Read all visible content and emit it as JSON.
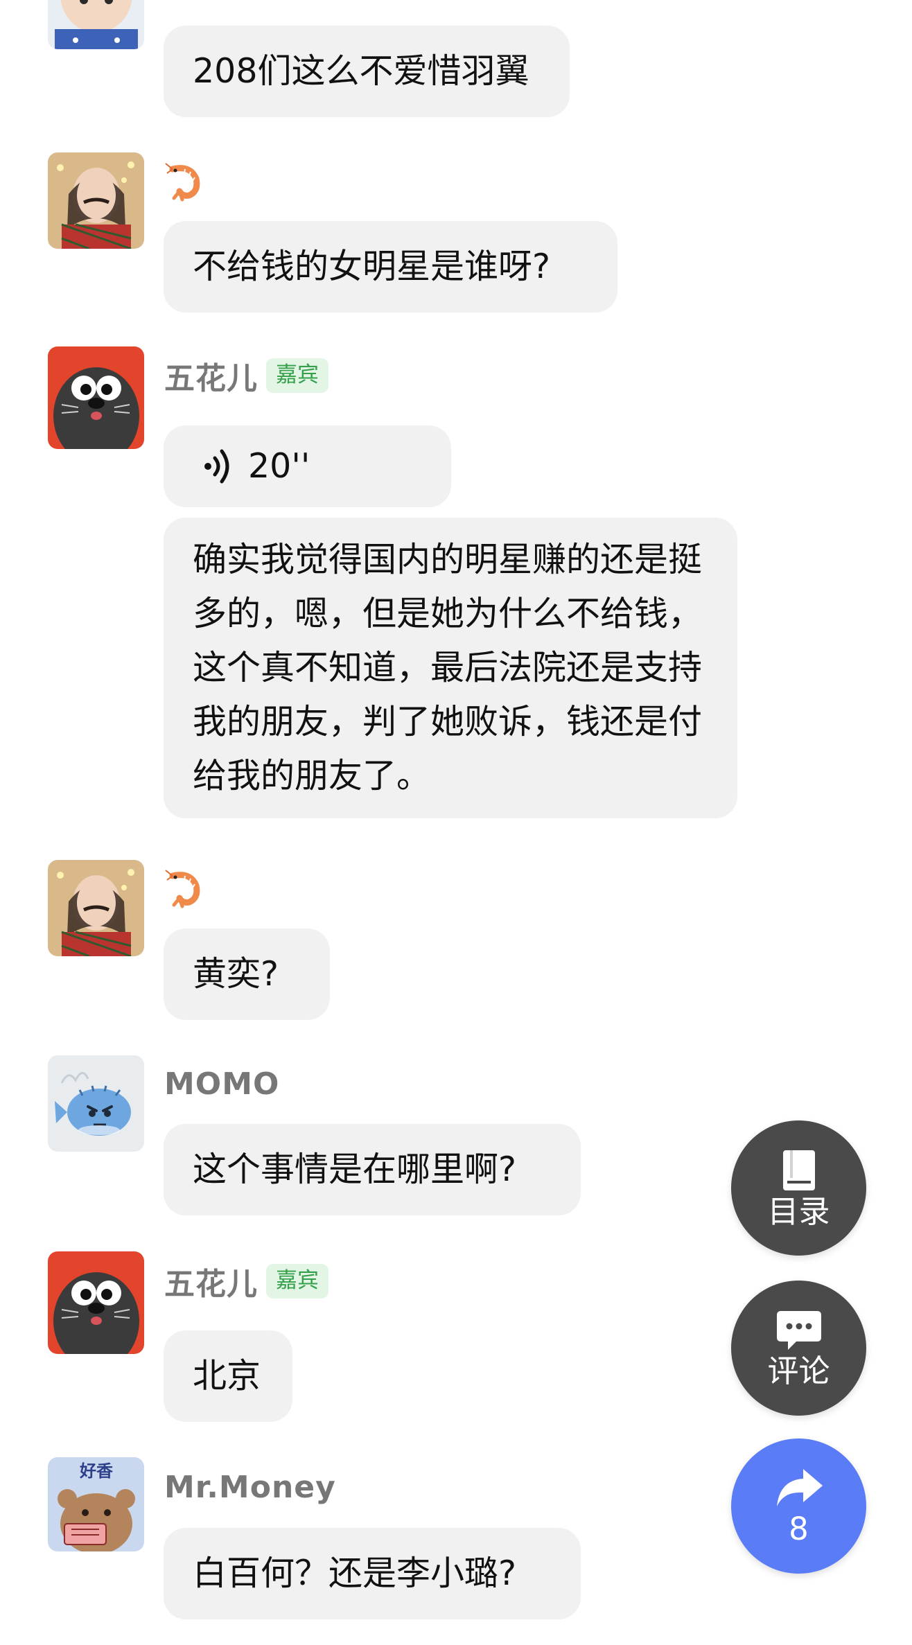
{
  "messages": [
    {
      "avatar": "girl-with-hat-avatar",
      "text": "208们这么不爱惜羽翼"
    },
    {
      "avatar": "girl-with-mustache-avatar",
      "tag": "shrimp-icon",
      "text": "不给钱的女明星是谁呀?"
    },
    {
      "avatar": "black-seal-avatar",
      "name": "五花儿",
      "badge": "嘉宾",
      "voice": "20''",
      "text": "确实我觉得国内的明星赚的还是挺多的，嗯，但是她为什么不给钱，这个真不知道，最后法院还是支持我的朋友，判了她败诉，钱还是付给我的朋友了。"
    },
    {
      "avatar": "girl-with-mustache-avatar",
      "tag": "shrimp-icon",
      "text": "黄奕?"
    },
    {
      "avatar": "blue-pufferfish-avatar",
      "name": "MOMO",
      "text": "这个事情是在哪里啊?"
    },
    {
      "avatar": "black-seal-avatar",
      "name": "五花儿",
      "badge": "嘉宾",
      "text": "北京"
    },
    {
      "avatar": "bear-with-sign-avatar",
      "avatar_text": "好香",
      "name": "Mr.Money",
      "text": "白百何？还是李小璐?"
    }
  ],
  "fab": {
    "catalog": {
      "label": "目录",
      "icon": "book-icon"
    },
    "comment": {
      "label": "评论",
      "icon": "chat-bubble-icon"
    },
    "share": {
      "count": "8",
      "icon": "share-arrow-icon"
    }
  },
  "colors": {
    "bubble": "#f1f1f1",
    "badge_bg": "#e3f6e6",
    "badge_text": "#35a04a",
    "fab_dark": "#4a4a4a",
    "fab_blue": "#5b7cf7"
  }
}
